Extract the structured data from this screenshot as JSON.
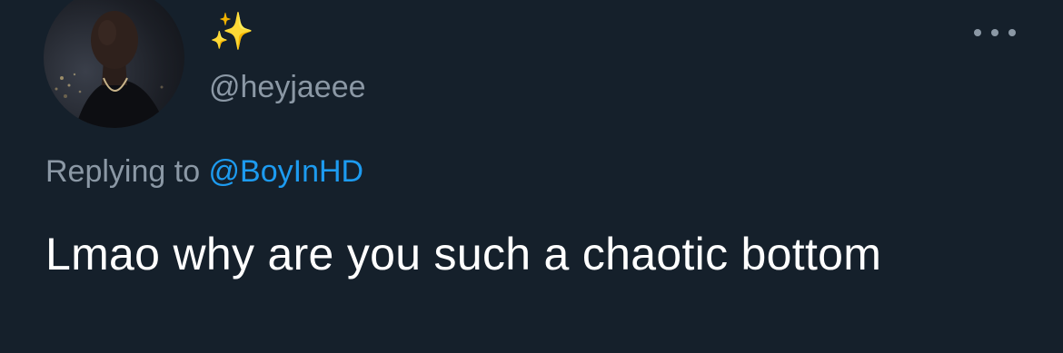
{
  "tweet": {
    "author": {
      "display_name": "✨",
      "handle": "@heyjaeee"
    },
    "reply_context": {
      "prefix": "Replying to",
      "mention": "@BoyInHD"
    },
    "text": "Lmao why are you such a chaotic bottom",
    "more_icon": "more-horizontal-icon"
  },
  "colors": {
    "background": "#15202b",
    "secondary_text": "#8b98a5",
    "link": "#1d9bf0",
    "primary_text": "#ffffff"
  }
}
